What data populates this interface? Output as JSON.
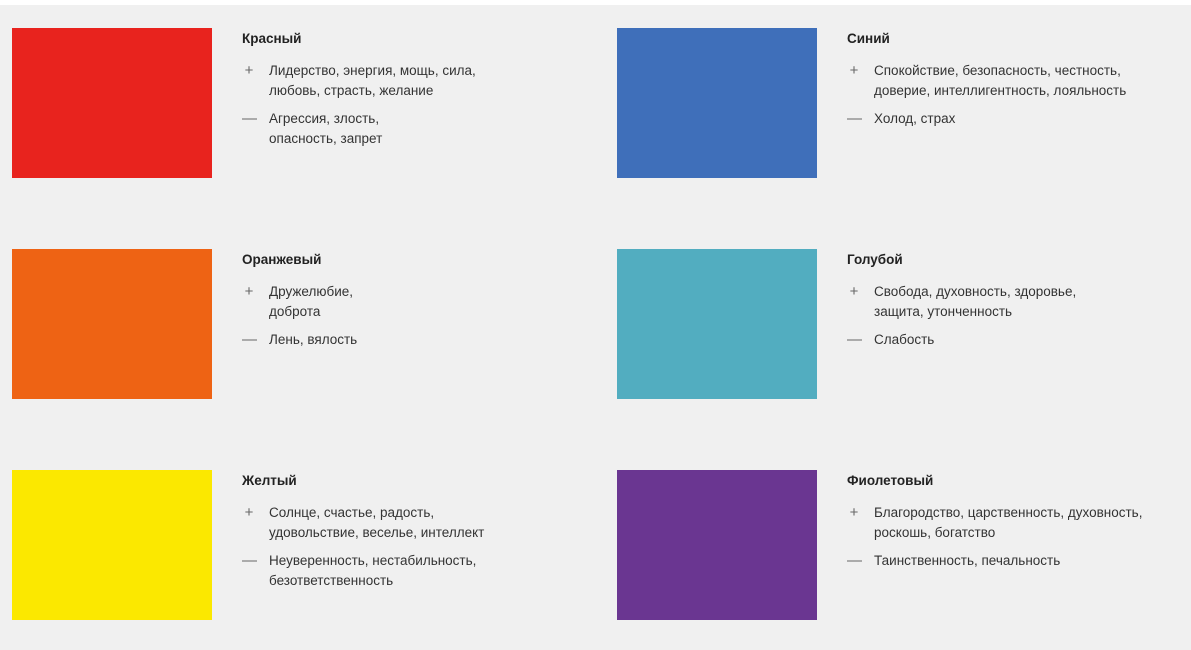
{
  "colors": [
    {
      "title": "Красный",
      "swatch": "#e8231e",
      "plus_sign": "+",
      "plus": "Лидерство, энергия, мощь, сила,\nлюбовь, страсть, желание",
      "minus_sign": "—",
      "minus": "Агрессия, злость,\nопасность, запрет"
    },
    {
      "title": "Синий",
      "swatch": "#3f6fba",
      "plus_sign": "+",
      "plus": "Спокойствие, безопасность, честность,\nдоверие, интеллигентность, лояльность",
      "minus_sign": "—",
      "minus": "Холод, страх"
    },
    {
      "title": "Оранжевый",
      "swatch": "#ee6314",
      "plus_sign": "+",
      "plus": "Дружелюбие,\nдоброта",
      "minus_sign": "—",
      "minus": "Лень, вялость"
    },
    {
      "title": "Голубой",
      "swatch": "#52adc0",
      "plus_sign": "+",
      "plus": "Свобода, духовность, здоровье,\nзащита, утонченность",
      "minus_sign": "—",
      "minus": "Слабость"
    },
    {
      "title": "Желтый",
      "swatch": "#fbe800",
      "plus_sign": "+",
      "plus": "Солнце, счастье, радость,\nудовольствие, веселье, интеллект",
      "minus_sign": "—",
      "minus": "Неуверенность, нестабильность,\nбезответственность"
    },
    {
      "title": "Фиолетовый",
      "swatch": "#6a3691",
      "plus_sign": "+",
      "plus": "Благородство, царственность, духовность,\nроскошь, богатство",
      "minus_sign": "—",
      "minus": "Таинственность,  печальность"
    }
  ]
}
